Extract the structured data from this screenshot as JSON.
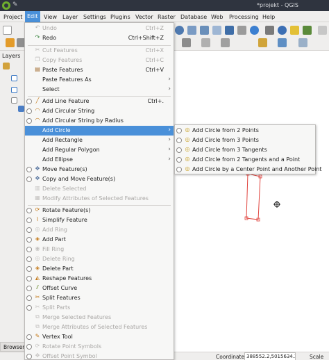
{
  "window": {
    "title": "*projekt - QGIS"
  },
  "menubar": [
    "Project",
    "Edit",
    "View",
    "Layer",
    "Settings",
    "Plugins",
    "Vector",
    "Raster",
    "Database",
    "Web",
    "Processing",
    "Help"
  ],
  "panels": {
    "layers_title": "Layers",
    "browser_tab": "Browser"
  },
  "statusbar": {
    "coordinate_label": "Coordinate",
    "coordinate_value": "388552.2,5015634.2",
    "scale_label": "Scale"
  },
  "edit_menu": [
    {
      "label": "Undo",
      "shortcut": "Ctrl+Z",
      "disabled": true
    },
    {
      "label": "Redo",
      "shortcut": "Ctrl+Shift+Z",
      "disabled": false
    },
    {
      "label": "Cut Features",
      "shortcut": "Ctrl+X",
      "disabled": true
    },
    {
      "label": "Copy Features",
      "shortcut": "Ctrl+C",
      "disabled": true
    },
    {
      "label": "Paste Features",
      "shortcut": "Ctrl+V",
      "disabled": false
    },
    {
      "label": "Paste Features As",
      "shortcut": "",
      "disabled": false,
      "submenu": true
    },
    {
      "label": "Select",
      "shortcut": "",
      "disabled": false,
      "submenu": true
    },
    {
      "label": "Add Line Feature",
      "shortcut": "Ctrl+.",
      "disabled": false
    },
    {
      "label": "Add Circular String",
      "shortcut": "",
      "disabled": false
    },
    {
      "label": "Add Circular String by Radius",
      "shortcut": "",
      "disabled": false
    },
    {
      "label": "Add Circle",
      "shortcut": "",
      "disabled": false,
      "submenu": true,
      "highlight": true
    },
    {
      "label": "Add Rectangle",
      "shortcut": "",
      "disabled": false,
      "submenu": true
    },
    {
      "label": "Add Regular Polygon",
      "shortcut": "",
      "disabled": false,
      "submenu": true
    },
    {
      "label": "Add Ellipse",
      "shortcut": "",
      "disabled": false,
      "submenu": true
    },
    {
      "label": "Move Feature(s)",
      "shortcut": "",
      "disabled": false
    },
    {
      "label": "Copy and Move Feature(s)",
      "shortcut": "",
      "disabled": false
    },
    {
      "label": "Delete Selected",
      "shortcut": "",
      "disabled": true
    },
    {
      "label": "Modify Attributes of Selected Features",
      "shortcut": "",
      "disabled": true
    },
    {
      "label": "Rotate Feature(s)",
      "shortcut": "",
      "disabled": false
    },
    {
      "label": "Simplify Feature",
      "shortcut": "",
      "disabled": false
    },
    {
      "label": "Add Ring",
      "shortcut": "",
      "disabled": true
    },
    {
      "label": "Add Part",
      "shortcut": "",
      "disabled": false
    },
    {
      "label": "Fill Ring",
      "shortcut": "",
      "disabled": true
    },
    {
      "label": "Delete Ring",
      "shortcut": "",
      "disabled": true
    },
    {
      "label": "Delete Part",
      "shortcut": "",
      "disabled": false
    },
    {
      "label": "Reshape Features",
      "shortcut": "",
      "disabled": false
    },
    {
      "label": "Offset Curve",
      "shortcut": "",
      "disabled": false
    },
    {
      "label": "Split Features",
      "shortcut": "",
      "disabled": false
    },
    {
      "label": "Split Parts",
      "shortcut": "",
      "disabled": true
    },
    {
      "label": "Merge Selected Features",
      "shortcut": "",
      "disabled": true
    },
    {
      "label": "Merge Attributes of Selected Features",
      "shortcut": "",
      "disabled": true
    },
    {
      "label": "Vertex Tool",
      "shortcut": "",
      "disabled": false
    },
    {
      "label": "Rotate Point Symbols",
      "shortcut": "",
      "disabled": true
    },
    {
      "label": "Offset Point Symbol",
      "shortcut": "",
      "disabled": true
    }
  ],
  "circle_submenu": [
    "Add Circle from 2 Points",
    "Add Circle from 3 Points",
    "Add Circle from 3 Tangents",
    "Add Circle from 2 Tangents and a Point",
    "Add Circle by a Center Point and Another Point"
  ],
  "colors": {
    "highlight": "#4a90d9",
    "titlebar": "#2f343f",
    "feature_outline": "#e0423c"
  }
}
